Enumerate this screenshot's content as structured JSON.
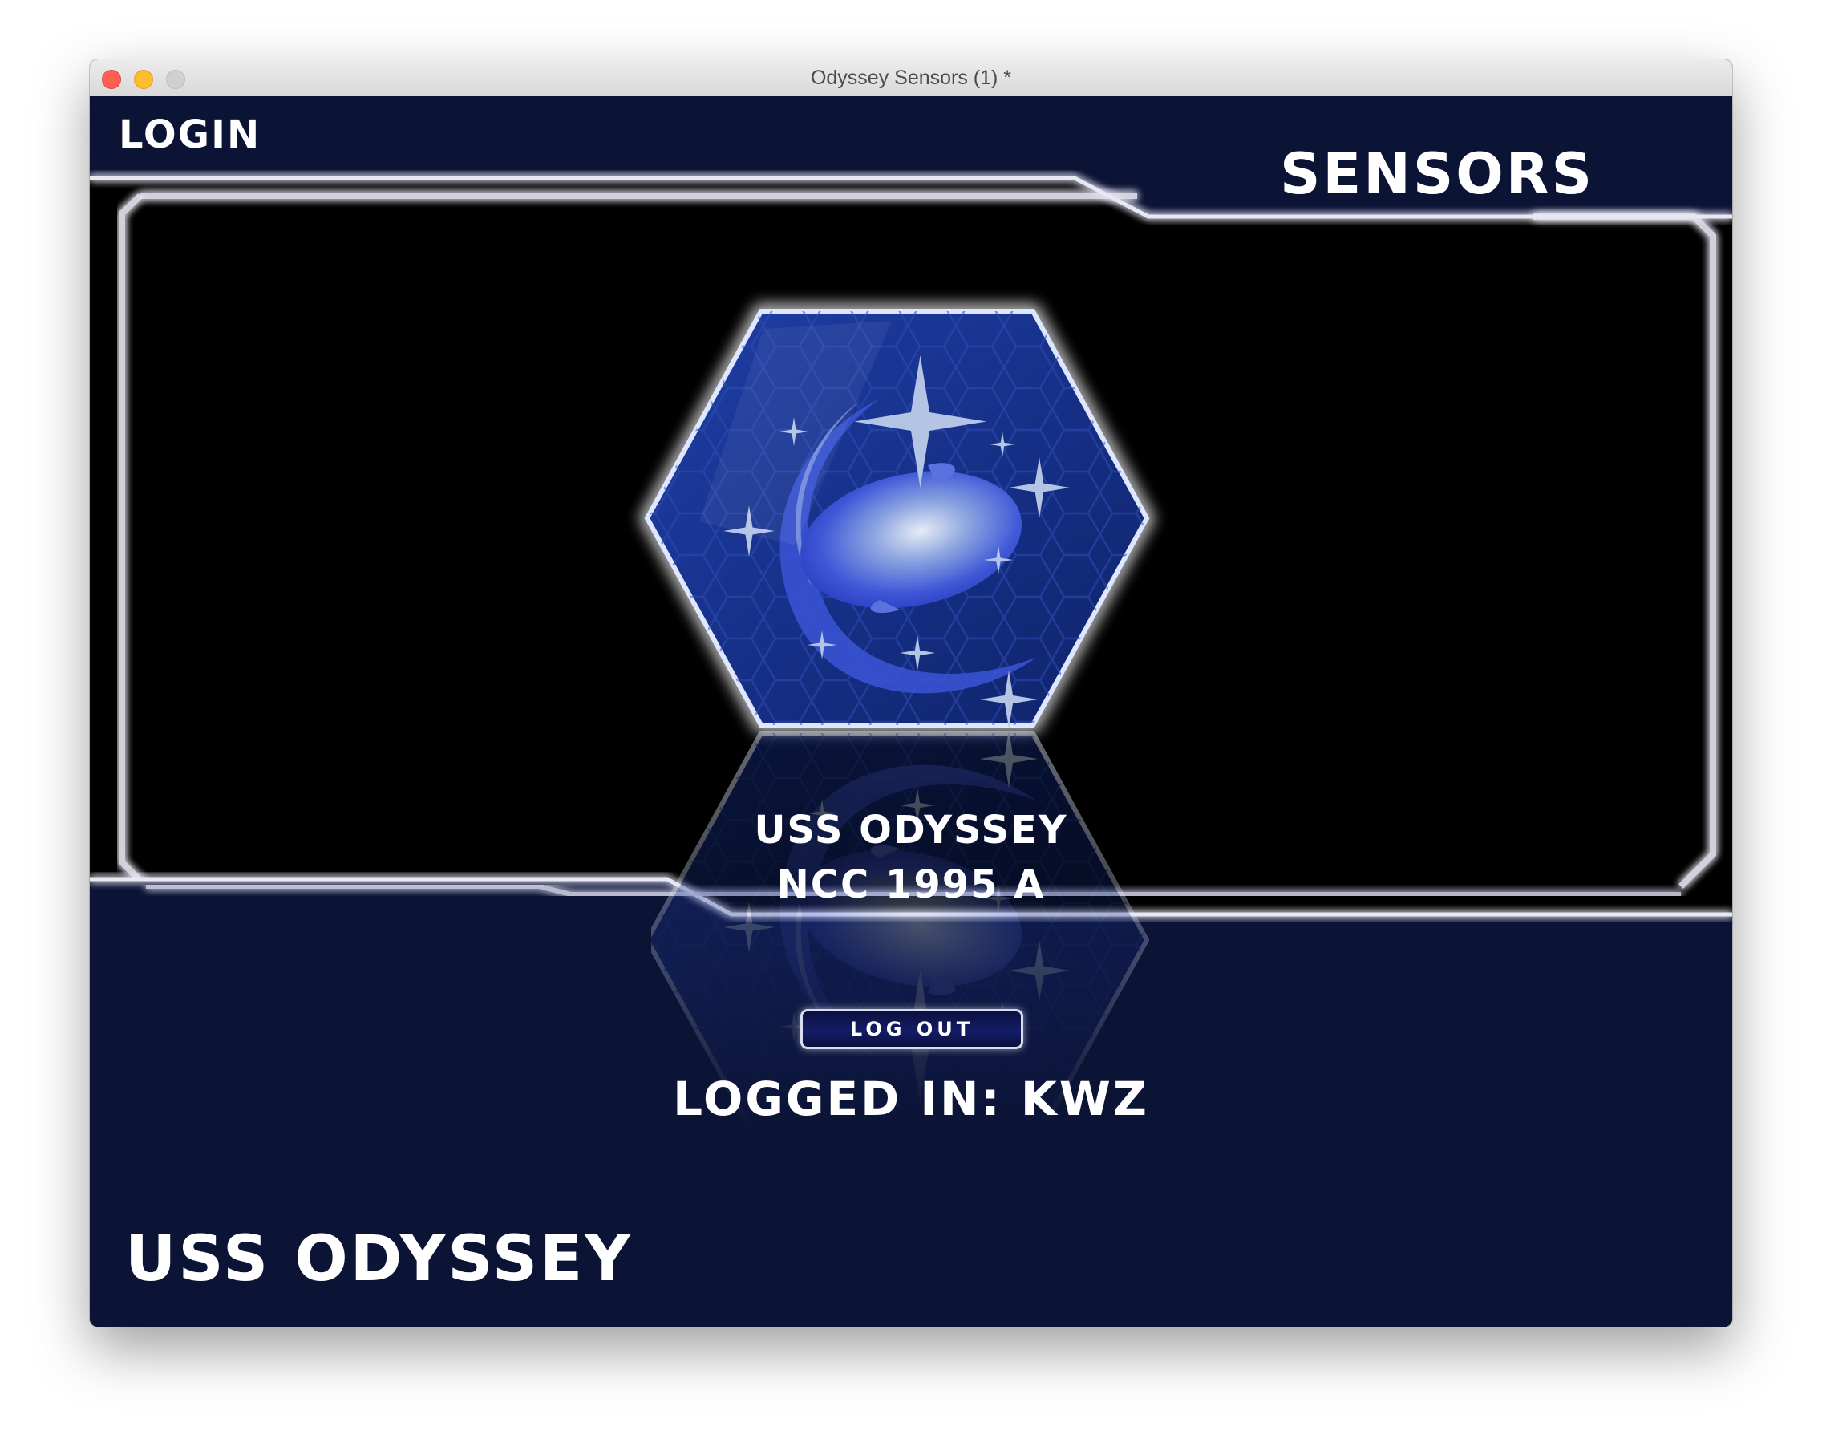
{
  "window": {
    "title": "Odyssey Sensors (1) *"
  },
  "header": {
    "login_label": "LOGIN",
    "sensors_label": "SENSORS"
  },
  "main": {
    "ship_name": "USS ODYSSEY",
    "ship_registry": "NCC 1995 A",
    "logout_label": "LOG OUT",
    "logged_in_text": "LOGGED IN: KWZ"
  },
  "footer": {
    "title": "USS ODYSSEY"
  },
  "colors": {
    "panel_navy": "#0c1436",
    "frame_glow": "#e8e8f4",
    "emblem_blue": "#1e3a9a",
    "emblem_light": "#9aaed8"
  },
  "icons": {
    "emblem": "hexagon-galaxy-emblem",
    "stars": "sparkle-star-icon"
  }
}
